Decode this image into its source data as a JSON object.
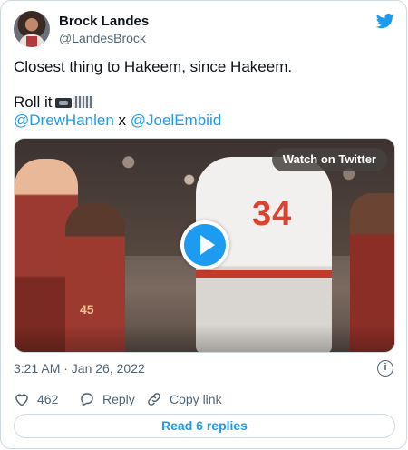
{
  "author": {
    "name": "Brock Landes",
    "handle": "@LandesBrock"
  },
  "tweet": {
    "line1": "Closest thing to Hakeem, since Hakeem.",
    "line2": "Roll it",
    "emojis": [
      "videocassette-icon",
      "film-frames-icon"
    ],
    "mention1": "@DrewHanlen",
    "separator": " x ",
    "mention2": "@JoelEmbiid"
  },
  "media": {
    "watch_label": "Watch on Twitter",
    "jersey_number": "34",
    "player_number_left": "45"
  },
  "timestamp": "3:21 AM · Jan 26, 2022",
  "info_glyph": "i",
  "actions": {
    "like_count": "462",
    "reply_label": "Reply",
    "copy_label": "Copy link"
  },
  "read_replies": "Read 6 replies",
  "colors": {
    "accent": "#1d9bf0",
    "secondary_text": "#536471",
    "border": "#cfd9de"
  }
}
